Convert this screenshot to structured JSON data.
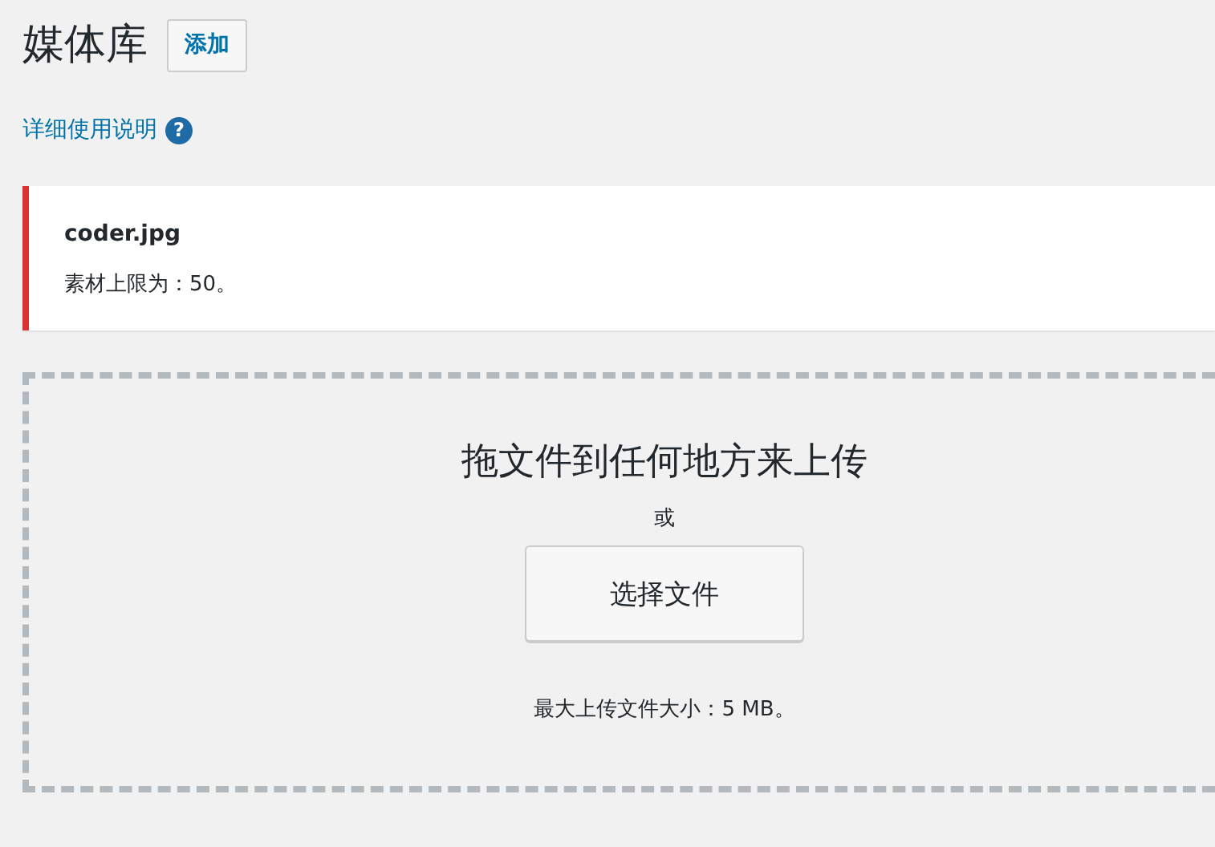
{
  "header": {
    "title": "媒体库",
    "add_button": "添加"
  },
  "help_link": {
    "label": "详细使用说明",
    "icon": "?"
  },
  "notice": {
    "error": true,
    "filename": "coder.jpg",
    "message": "素材上限为：50。"
  },
  "upload": {
    "instructions": "拖文件到任何地方来上传",
    "or": "或",
    "button": "选择文件",
    "max_size": "最大上传文件大小：5 MB。"
  }
}
